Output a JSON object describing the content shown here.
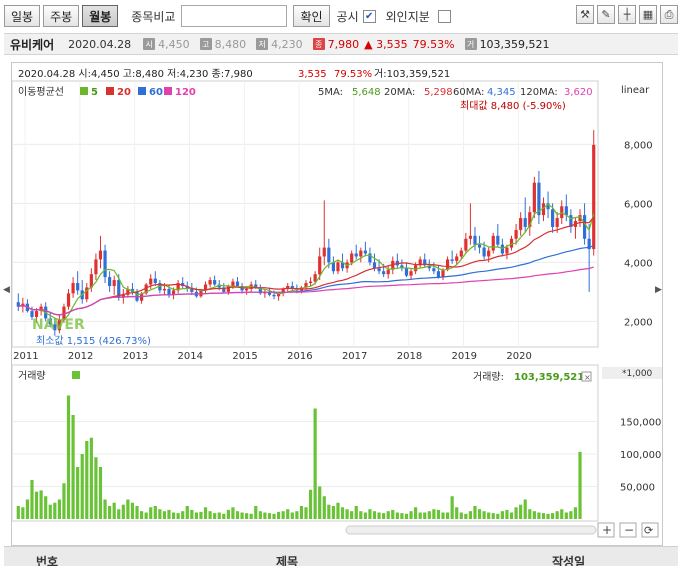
{
  "toolbar": {
    "tabs": [
      {
        "label": "일봉",
        "active": false
      },
      {
        "label": "주봉",
        "active": false
      },
      {
        "label": "월봉",
        "active": true
      }
    ],
    "compare_label": "종목비교",
    "compare_placeholder": "",
    "confirm_label": "확인",
    "notice_label": "공시",
    "notice_checked": true,
    "foreign_label": "외인지분",
    "foreign_checked": false,
    "icons": [
      "tools-icon",
      "draw-icon",
      "crosshair-icon",
      "grid-icon",
      "print-icon"
    ]
  },
  "infobar": {
    "stock_name": "유비케어",
    "date": "2020.04.28",
    "open_tag": "시",
    "open": "4,450",
    "high_tag": "고",
    "high": "8,480",
    "low_tag": "저",
    "low": "4,230",
    "close_tag": "종",
    "close": "7,980",
    "change": "▲ 3,535",
    "change_pct": "79.53%",
    "volume_tag": "거",
    "volume": "103,359,521"
  },
  "chart_header": {
    "line": "2020.04.28 시:4,450 고:8,480 저:4,230 종:7,980",
    "change": "3,535",
    "change_pct": "79.53%",
    "volume": "거:103,359,521",
    "scale": "linear"
  },
  "ma_legend": {
    "title": "이동평균선",
    "items": [
      {
        "label": "5",
        "color": "#6ab829"
      },
      {
        "label": "20",
        "color": "#d93030"
      },
      {
        "label": "60",
        "color": "#2f6fd6"
      },
      {
        "label": "120",
        "color": "#e040b0"
      }
    ]
  },
  "ma_values": [
    {
      "label": "5MA:",
      "value": "5,648",
      "color": "#4a9a1a"
    },
    {
      "label": "20MA:",
      "value": "5,298",
      "color": "#d93030"
    },
    {
      "label": "60MA:",
      "value": "4,345",
      "color": "#2f6fd6"
    },
    {
      "label": "120MA:",
      "value": "3,620",
      "color": "#e040b0"
    }
  ],
  "annotations": {
    "max_label": "최대값 8,480 (-5.90%)",
    "min_label": "최소값 1,515 (426.73%)",
    "watermark": "NAVER"
  },
  "volume_panel": {
    "title": "거래량",
    "value_label": "거래량:",
    "value": "103,359,521",
    "unit": "*1,000"
  },
  "bottom_table": {
    "col1": "번호",
    "col2": "제목",
    "col3": "작성일"
  },
  "chart_data": {
    "type": "candlestick",
    "x_years": [
      "2011",
      "2012",
      "2013",
      "2014",
      "2015",
      "2016",
      "2017",
      "2018",
      "2019",
      "2020"
    ],
    "y_ticks": [
      2000,
      4000,
      6000,
      8000
    ],
    "y_range": [
      1200,
      9400
    ],
    "volume_ticks": [
      50000,
      100000,
      150000
    ],
    "volume_range": [
      0,
      200000
    ],
    "ohlc": [
      [
        2650,
        2950,
        2350,
        2500
      ],
      [
        2500,
        2800,
        2300,
        2600
      ],
      [
        2600,
        2750,
        2300,
        2350
      ],
      [
        2350,
        2500,
        2050,
        2150
      ],
      [
        2150,
        2450,
        1950,
        2350
      ],
      [
        2350,
        2600,
        2200,
        2500
      ],
      [
        2500,
        2650,
        2000,
        2100
      ],
      [
        2100,
        2300,
        1800,
        1900
      ],
      [
        1900,
        2100,
        1515,
        1700
      ],
      [
        1700,
        2200,
        1600,
        2050
      ],
      [
        2050,
        2600,
        1950,
        2500
      ],
      [
        2500,
        3100,
        2400,
        2950
      ],
      [
        2950,
        3500,
        2800,
        3300
      ],
      [
        3300,
        3700,
        2900,
        3050
      ],
      [
        3050,
        3400,
        2600,
        2750
      ],
      [
        2750,
        3300,
        2650,
        3150
      ],
      [
        3150,
        3800,
        3000,
        3600
      ],
      [
        3600,
        4300,
        3400,
        4100
      ],
      [
        4100,
        4900,
        3800,
        4400
      ],
      [
        4400,
        4600,
        3300,
        3500
      ],
      [
        3500,
        3700,
        3000,
        3200
      ],
      [
        3200,
        3550,
        2900,
        3400
      ],
      [
        3400,
        3600,
        2700,
        2800
      ],
      [
        2800,
        3100,
        2600,
        2900
      ],
      [
        2900,
        3200,
        2800,
        3100
      ],
      [
        3100,
        3300,
        2900,
        3000
      ],
      [
        3000,
        3100,
        2650,
        2700
      ],
      [
        2700,
        3000,
        2600,
        2950
      ],
      [
        2950,
        3300,
        2900,
        3250
      ],
      [
        3250,
        3600,
        3100,
        3450
      ],
      [
        3450,
        3700,
        3200,
        3300
      ],
      [
        3300,
        3400,
        2950,
        3050
      ],
      [
        3050,
        3300,
        2900,
        3100
      ],
      [
        3100,
        3250,
        2800,
        2900
      ],
      [
        2900,
        3150,
        2750,
        3050
      ],
      [
        3050,
        3400,
        2950,
        3300
      ],
      [
        3300,
        3500,
        3100,
        3200
      ],
      [
        3200,
        3350,
        3000,
        3100
      ],
      [
        3100,
        3300,
        2900,
        3000
      ],
      [
        3000,
        3150,
        2800,
        2850
      ],
      [
        2850,
        3100,
        2800,
        3050
      ],
      [
        3050,
        3350,
        2950,
        3250
      ],
      [
        3250,
        3500,
        3150,
        3400
      ],
      [
        3400,
        3550,
        3200,
        3250
      ],
      [
        3250,
        3400,
        3050,
        3150
      ],
      [
        3150,
        3300,
        2950,
        3000
      ],
      [
        3000,
        3250,
        2900,
        3200
      ],
      [
        3200,
        3450,
        3100,
        3350
      ],
      [
        3350,
        3500,
        3150,
        3200
      ],
      [
        3200,
        3300,
        2950,
        3050
      ],
      [
        3050,
        3200,
        2900,
        3100
      ],
      [
        3100,
        3350,
        3000,
        3250
      ],
      [
        3250,
        3400,
        3100,
        3150
      ],
      [
        3150,
        3250,
        2900,
        2950
      ],
      [
        2950,
        3100,
        2800,
        3000
      ],
      [
        3000,
        3150,
        2850,
        2900
      ],
      [
        2900,
        3050,
        2750,
        2850
      ],
      [
        2850,
        3000,
        2700,
        2950
      ],
      [
        2950,
        3150,
        2850,
        3100
      ],
      [
        3100,
        3300,
        3000,
        3200
      ],
      [
        3200,
        3350,
        3050,
        3100
      ],
      [
        3100,
        3250,
        2950,
        3050
      ],
      [
        3050,
        3200,
        2950,
        3150
      ],
      [
        3150,
        3400,
        3050,
        3300
      ],
      [
        3300,
        3500,
        3200,
        3350
      ],
      [
        3350,
        3700,
        3250,
        3600
      ],
      [
        3600,
        4500,
        3400,
        4200
      ],
      [
        4200,
        6100,
        3900,
        4500
      ],
      [
        4500,
        4800,
        3800,
        4000
      ],
      [
        4000,
        4200,
        3600,
        3700
      ],
      [
        3700,
        4100,
        3600,
        4000
      ],
      [
        4000,
        4300,
        3700,
        3800
      ],
      [
        3800,
        4100,
        3650,
        4000
      ],
      [
        4000,
        4400,
        3900,
        4300
      ],
      [
        4300,
        4600,
        4100,
        4200
      ],
      [
        4200,
        4500,
        4000,
        4400
      ],
      [
        4400,
        4700,
        4200,
        4300
      ],
      [
        4300,
        4500,
        3900,
        4000
      ],
      [
        4000,
        4300,
        3700,
        3800
      ],
      [
        3800,
        4100,
        3600,
        3700
      ],
      [
        3700,
        3950,
        3500,
        3600
      ],
      [
        3600,
        3900,
        3450,
        3750
      ],
      [
        3750,
        4200,
        3600,
        4050
      ],
      [
        4050,
        4300,
        3800,
        3900
      ],
      [
        3900,
        4100,
        3700,
        3800
      ],
      [
        3800,
        4000,
        3500,
        3550
      ],
      [
        3550,
        3800,
        3400,
        3700
      ],
      [
        3700,
        4000,
        3600,
        3900
      ],
      [
        3900,
        4200,
        3800,
        4100
      ],
      [
        4100,
        4300,
        3850,
        3900
      ],
      [
        3900,
        4100,
        3700,
        3800
      ],
      [
        3800,
        4000,
        3600,
        3700
      ],
      [
        3700,
        3900,
        3450,
        3500
      ],
      [
        3500,
        3800,
        3400,
        3750
      ],
      [
        3750,
        4200,
        3700,
        4100
      ],
      [
        4100,
        4400,
        3950,
        4050
      ],
      [
        4050,
        4300,
        3900,
        4200
      ],
      [
        4200,
        4500,
        4100,
        4400
      ],
      [
        4400,
        5000,
        4300,
        4800
      ],
      [
        4800,
        6000,
        4600,
        4900
      ],
      [
        4900,
        5200,
        4400,
        4600
      ],
      [
        4600,
        4900,
        4300,
        4500
      ],
      [
        4500,
        4700,
        4100,
        4200
      ],
      [
        4200,
        4500,
        4000,
        4400
      ],
      [
        4400,
        5000,
        4300,
        4900
      ],
      [
        4900,
        5300,
        4500,
        4600
      ],
      [
        4600,
        4800,
        4200,
        4300
      ],
      [
        4300,
        4600,
        4100,
        4500
      ],
      [
        4500,
        4900,
        4400,
        4800
      ],
      [
        4800,
        5300,
        4600,
        5100
      ],
      [
        5100,
        5700,
        4900,
        5500
      ],
      [
        5500,
        6200,
        5000,
        5200
      ],
      [
        5200,
        5900,
        4900,
        5700
      ],
      [
        5700,
        6900,
        5500,
        6700
      ],
      [
        6700,
        7100,
        5300,
        5600
      ],
      [
        5600,
        6200,
        5400,
        6000
      ],
      [
        6000,
        6400,
        5500,
        5800
      ],
      [
        5800,
        6000,
        5000,
        5200
      ],
      [
        5200,
        5700,
        5000,
        5500
      ],
      [
        5500,
        6100,
        5300,
        5900
      ],
      [
        5900,
        6300,
        5400,
        5600
      ],
      [
        5600,
        5800,
        5000,
        5200
      ],
      [
        5200,
        5500,
        4800,
        5400
      ],
      [
        5400,
        5800,
        5200,
        5600
      ],
      [
        5600,
        6000,
        4600,
        4800
      ],
      [
        4800,
        5300,
        3000,
        4450
      ],
      [
        4450,
        8480,
        4230,
        7980
      ]
    ],
    "volume": [
      20000,
      18000,
      30000,
      60000,
      42000,
      44000,
      35000,
      22000,
      25000,
      30000,
      55000,
      190000,
      160000,
      80000,
      100000,
      120000,
      125000,
      95000,
      80000,
      30000,
      20000,
      25000,
      15000,
      22000,
      30000,
      25000,
      20000,
      12000,
      10000,
      18000,
      20000,
      15000,
      12000,
      14000,
      10000,
      9000,
      12000,
      20000,
      14000,
      10000,
      11000,
      18000,
      12000,
      9000,
      10000,
      8000,
      14000,
      18000,
      12000,
      10000,
      9000,
      8000,
      20000,
      12000,
      10000,
      9000,
      8000,
      11000,
      12000,
      15000,
      10000,
      12000,
      20000,
      18000,
      45000,
      170000,
      50000,
      35000,
      22000,
      20000,
      25000,
      18000,
      15000,
      12000,
      20000,
      12000,
      10000,
      15000,
      12000,
      10000,
      9000,
      12000,
      14000,
      10000,
      9000,
      8000,
      12000,
      18000,
      10000,
      10000,
      12000,
      15000,
      14000,
      10000,
      10000,
      35000,
      18000,
      10000,
      8000,
      12000,
      20000,
      15000,
      12000,
      10000,
      9000,
      8000,
      12000,
      14000,
      10000,
      18000,
      22000,
      30000,
      15000,
      12000,
      10000,
      9000,
      8000,
      9000,
      12000,
      15000,
      10000,
      12000,
      18000,
      103359
    ]
  }
}
